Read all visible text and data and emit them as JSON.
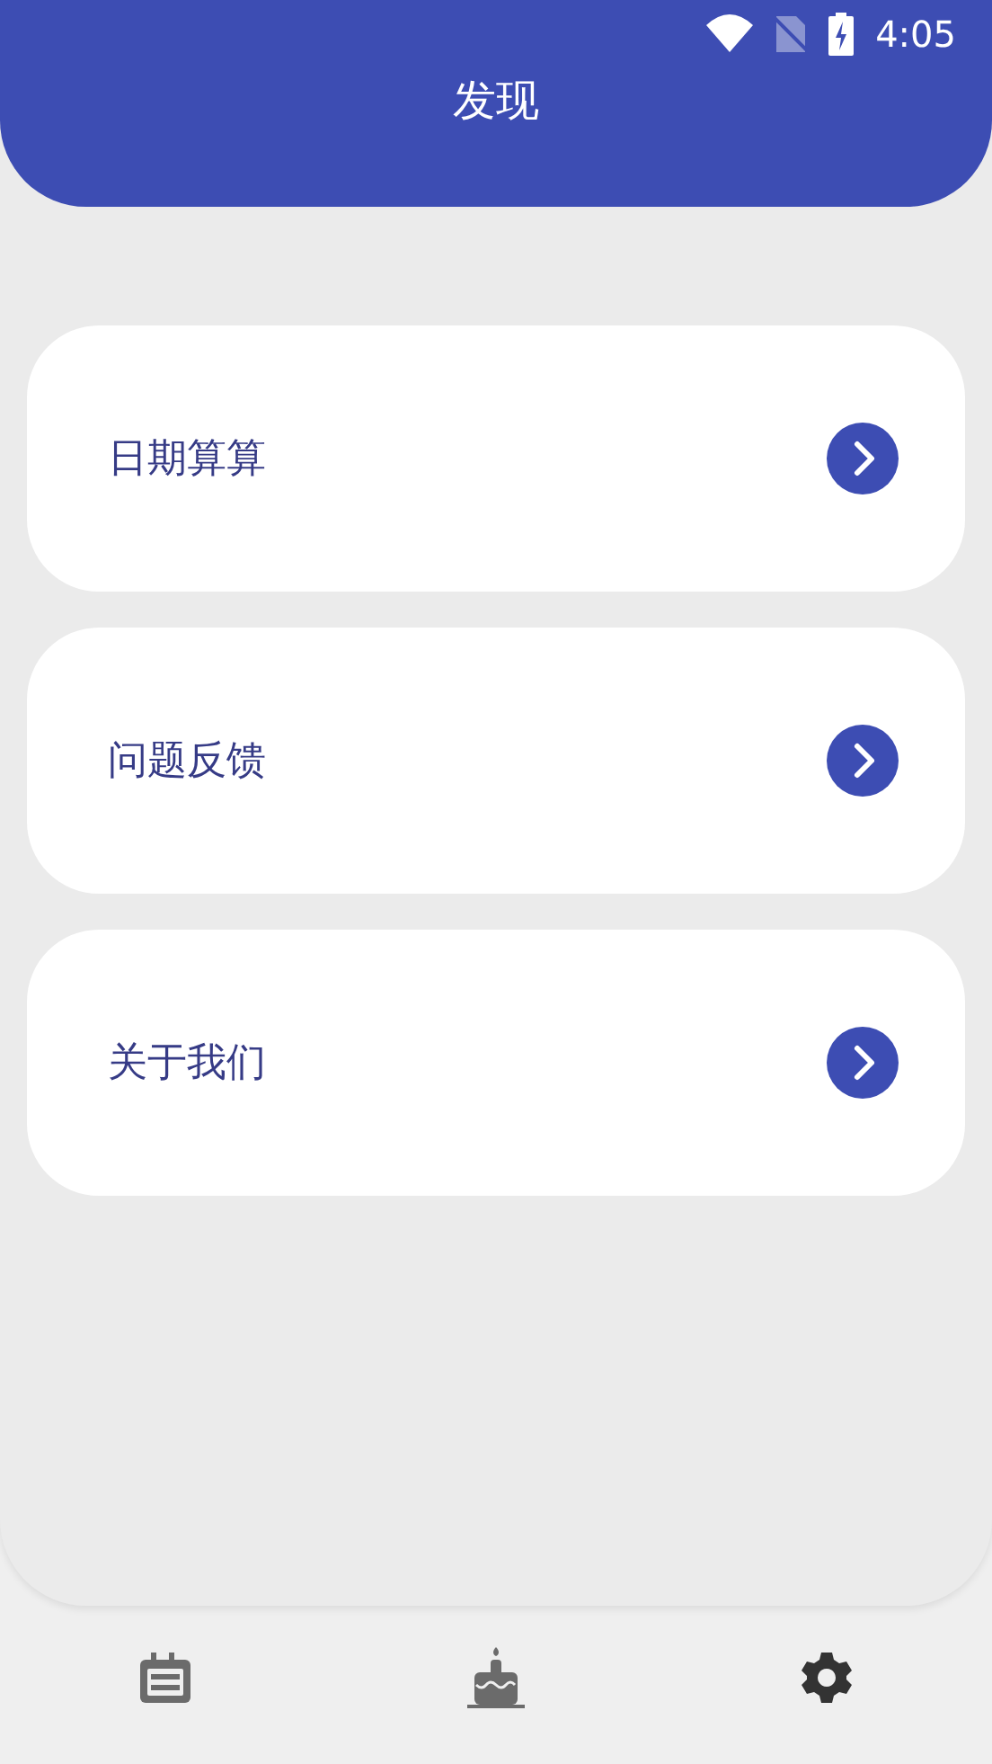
{
  "status_bar": {
    "time": "4:05"
  },
  "header": {
    "title": "发现"
  },
  "menu": [
    {
      "label": "日期算算"
    },
    {
      "label": "问题反馈"
    },
    {
      "label": "关于我们"
    }
  ],
  "bottom_nav": [
    {
      "kind": "calendar",
      "selected": false
    },
    {
      "kind": "cake",
      "selected": false
    },
    {
      "kind": "settings",
      "selected": true
    }
  ]
}
